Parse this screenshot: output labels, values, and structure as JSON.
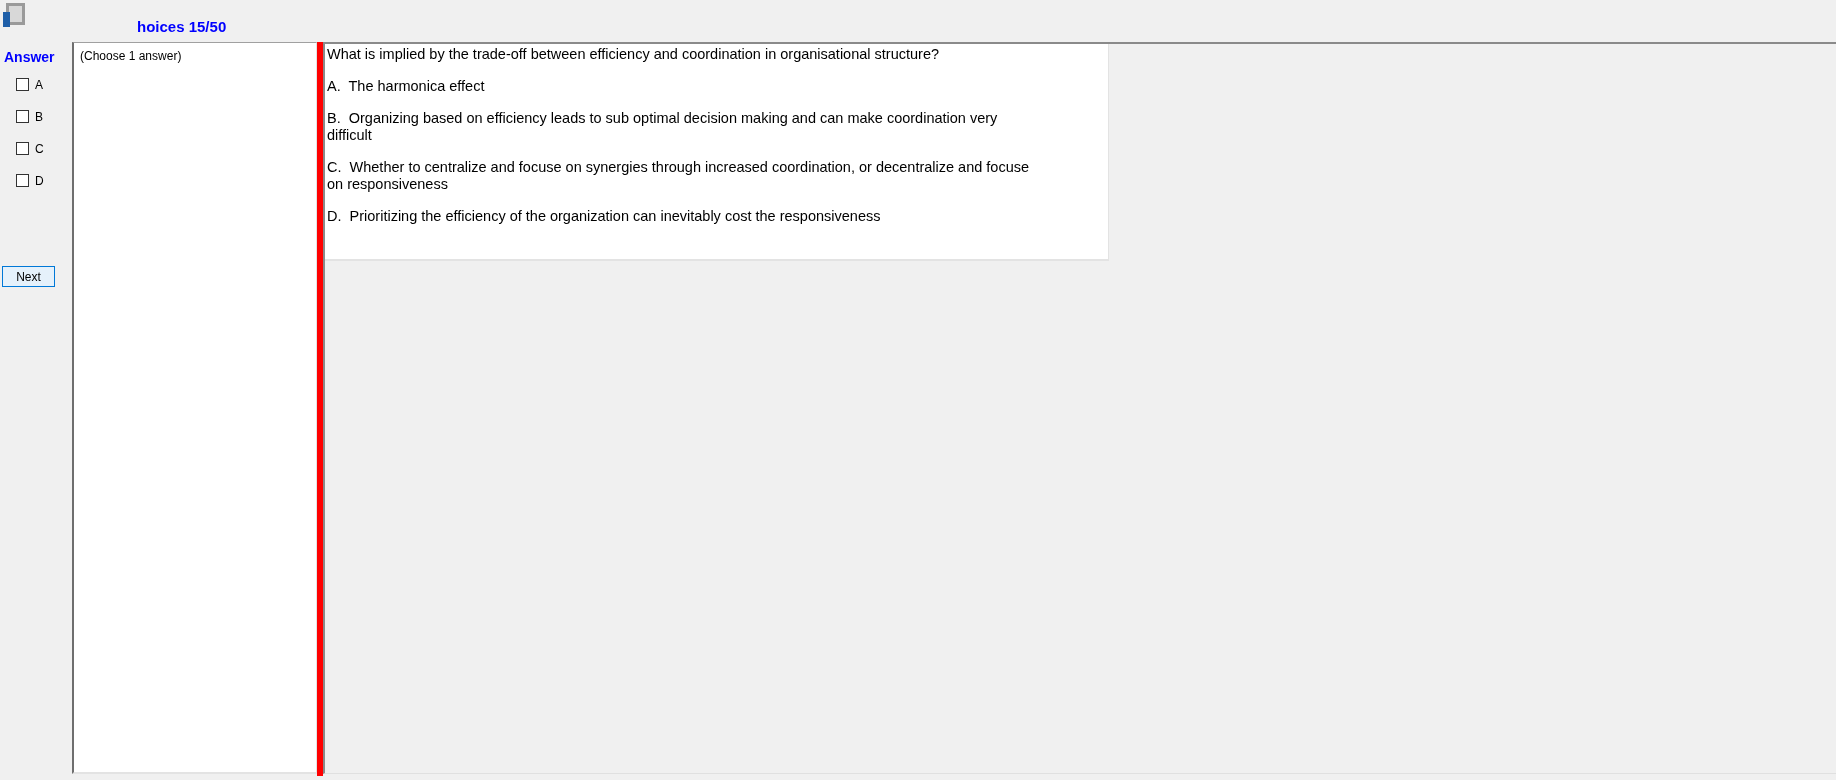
{
  "window": {
    "title": "hoices 15/50"
  },
  "answer_panel": {
    "heading": "Answer",
    "options": [
      {
        "label": "A",
        "checked": false
      },
      {
        "label": "B",
        "checked": false
      },
      {
        "label": "C",
        "checked": false
      },
      {
        "label": "D",
        "checked": false
      }
    ],
    "next_button": "Next"
  },
  "instructions": "(Choose 1 answer)",
  "question": {
    "text": "What is implied by the trade-off between efficiency and coordination in organisational structure?",
    "choices": [
      "A.  The harmonica effect",
      "B.  Organizing based on efficiency leads to sub optimal decision making and can make coordination very difficult",
      "C.  Whether to centralize and focuse on synergies through increased coordination, or decentralize and focuse on responsiveness",
      "D.  Prioritizing the efficiency of the organization can inevitably cost the responsiveness"
    ]
  }
}
